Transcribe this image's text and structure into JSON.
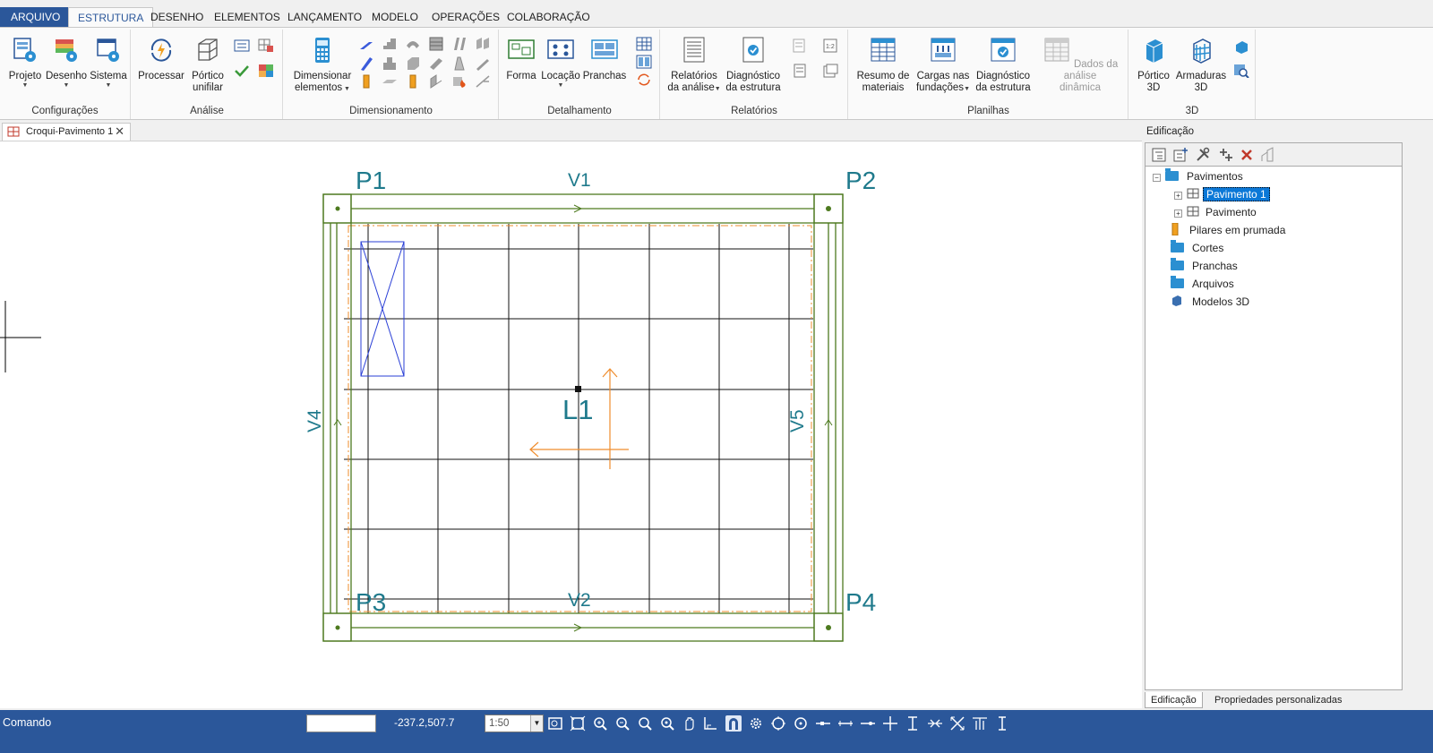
{
  "ribbon_tabs": {
    "arquivo": "ARQUIVO",
    "estrutura": "ESTRUTURA",
    "desenho": "DESENHO",
    "elementos": "ELEMENTOS",
    "lancamento": "LANÇAMENTO",
    "modelo": "MODELO",
    "operacoes": "OPERAÇÕES",
    "colaboracao": "COLABORAÇÃO"
  },
  "groups": {
    "configuracoes": {
      "label": "Configurações",
      "projeto": "Projeto",
      "desenho": "Desenho",
      "sistema": "Sistema"
    },
    "analise": {
      "label": "Análise",
      "processar": "Processar",
      "portico_1": "Pórtico",
      "portico_2": "unifilar"
    },
    "dimensionamento": {
      "label": "Dimensionamento",
      "dim_1": "Dimensionar",
      "dim_2": "elementos"
    },
    "detalhamento": {
      "label": "Detalhamento",
      "forma": "Forma",
      "locacao": "Locação",
      "pranchas": "Pranchas"
    },
    "relatorios": {
      "label": "Relatórios",
      "rel_1a": "Relatórios",
      "rel_1b": "da análise",
      "rel_2a": "Diagnóstico",
      "rel_2b": "da estrutura"
    },
    "planilhas": {
      "label": "Planilhas",
      "p1a": "Resumo de",
      "p1b": "materiais",
      "p2a": "Cargas nas",
      "p2b": "fundações",
      "p3a": "Diagnóstico",
      "p3b": "da estrutura",
      "p4a": "Dados da análise",
      "p4b": "dinâmica"
    },
    "tres_d": {
      "label": "3D",
      "p1a": "Pórtico",
      "p1b": "3D",
      "p2a": "Armaduras",
      "p2b": "3D"
    }
  },
  "document_tab": {
    "title": "Croqui-Pavimento 1"
  },
  "drawing": {
    "pillars": [
      "P1",
      "P2",
      "P3",
      "P4"
    ],
    "beams": [
      "V1",
      "V2",
      "V4",
      "V5"
    ],
    "slab": "L1"
  },
  "panel": {
    "title": "Edificação",
    "tree": {
      "pavimentos": "Pavimentos",
      "pavimento1": "Pavimento 1",
      "pavimento": "Pavimento",
      "pilares": "Pilares em prumada",
      "cortes": "Cortes",
      "pranchas": "Pranchas",
      "arquivos": "Arquivos",
      "modelos3d": "Modelos 3D"
    },
    "bottom_tabs": {
      "edificacao": "Edificação",
      "propriedades": "Propriedades personalizadas"
    }
  },
  "status": {
    "comando": "Comando",
    "coords": "-237.2,507.7",
    "scale": "1:50"
  },
  "colors": {
    "ribbon_blue": "#2b579a",
    "beam_green": "#4d7a1f",
    "label_teal": "#1f7a8c",
    "slab_orange": "#ef8c2c",
    "opening_blue": "#2a3fd6"
  }
}
